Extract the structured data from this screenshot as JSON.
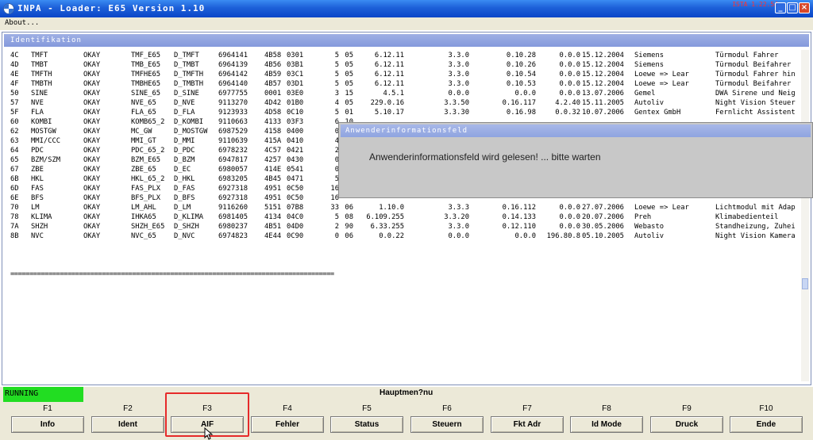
{
  "window": {
    "title": "INPA - Loader:  E65 Version 1.10",
    "watermark": "ISTA 1.22.54",
    "icons": {
      "minimize": "minimize-icon",
      "maximize": "maximize-icon",
      "close": "close-icon"
    }
  },
  "menu": {
    "about": "About..."
  },
  "panel": {
    "title": "Identifikation"
  },
  "table": {
    "rows": [
      [
        "4C",
        "TMFT",
        "OKAY",
        "TMF_E65",
        "D_TMFT",
        "6964141",
        "4B58",
        "0301",
        "5",
        "05",
        "6.12.11",
        "3.3.0",
        "0.10.28",
        "0.0.0",
        "15.12.2004",
        "Siemens",
        "Türmodul Fahrer"
      ],
      [
        "4D",
        "TMBT",
        "OKAY",
        "TMB_E65",
        "D_TMBT",
        "6964139",
        "4B56",
        "03B1",
        "5",
        "05",
        "6.12.11",
        "3.3.0",
        "0.10.26",
        "0.0.0",
        "15.12.2004",
        "Siemens",
        "Türmodul Beifahrer"
      ],
      [
        "4E",
        "TMFTH",
        "OKAY",
        "TMFHE65",
        "D_TMFTH",
        "6964142",
        "4B59",
        "03C1",
        "5",
        "05",
        "6.12.11",
        "3.3.0",
        "0.10.54",
        "0.0.0",
        "15.12.2004",
        "Loewe => Lear",
        "Türmodul Fahrer hin"
      ],
      [
        "4F",
        "TMBTH",
        "OKAY",
        "TMBHE65",
        "D_TMBTH",
        "6964140",
        "4B57",
        "03D1",
        "5",
        "05",
        "6.12.11",
        "3.3.0",
        "0.10.53",
        "0.0.0",
        "15.12.2004",
        "Loewe => Lear",
        "Türmodul Beifahrer"
      ],
      [
        "50",
        "SINE",
        "OKAY",
        "SINE_65",
        "D_SINE",
        "6977755",
        "0001",
        "03E0",
        "3",
        "15",
        "4.5.1",
        "0.0.0",
        "0.0.0",
        "0.0.0",
        "13.07.2006",
        "Gemel",
        "DWA Sirene und Neig"
      ],
      [
        "57",
        "NVE",
        "OKAY",
        "NVE_65",
        "D_NVE",
        "9113270",
        "4D42",
        "01B0",
        "4",
        "05",
        "229.0.16",
        "3.3.50",
        "0.16.117",
        "4.2.40",
        "15.11.2005",
        "Autoliv",
        "Night Vision Steuer"
      ],
      [
        "5F",
        "FLA",
        "OKAY",
        "FLA_65",
        "D_FLA",
        "9123933",
        "4D58",
        "0C10",
        "5",
        "01",
        "5.10.17",
        "3.3.30",
        "0.16.98",
        "0.0.32",
        "10.07.2006",
        "Gentex GmbH",
        "Fernlicht Assistent"
      ],
      [
        "60",
        "KOMBI",
        "OKAY",
        "KOMB65_2",
        "D_KOMBI",
        "9110663",
        "4133",
        "03F3",
        "6",
        "10",
        "",
        "",
        "",
        "",
        "",
        "",
        ""
      ],
      [
        "62",
        "MOSTGW",
        "OKAY",
        "MC_GW",
        "D_MOSTGW",
        "6987529",
        "4158",
        "0400",
        "0",
        "",
        "",
        "",
        "",
        "",
        "",
        "",
        ""
      ],
      [
        "63",
        "MMI/CCC",
        "OKAY",
        "MMI_GT",
        "D_MMI",
        "9110639",
        "415A",
        "0410",
        "4",
        "",
        "",
        "",
        "",
        "",
        "",
        "",
        ""
      ],
      [
        "64",
        "PDC",
        "OKAY",
        "PDC_65_2",
        "D_PDC",
        "6978232",
        "4C57",
        "0421",
        "2",
        "",
        "",
        "",
        "",
        "",
        "",
        "",
        ""
      ],
      [
        "65",
        "BZM/SZM",
        "OKAY",
        "BZM_E65",
        "D_BZM",
        "6947817",
        "4257",
        "0430",
        "0",
        "",
        "",
        "",
        "",
        "",
        "",
        "",
        ""
      ],
      [
        "67",
        "ZBE",
        "OKAY",
        "ZBE_65",
        "D_EC",
        "6980057",
        "414E",
        "0541",
        "0",
        "",
        "",
        "",
        "",
        "",
        "",
        "",
        ""
      ],
      [
        "6B",
        "HKL",
        "OKAY",
        "HKL_65_2",
        "D_HKL",
        "6983205",
        "4B45",
        "0471",
        "5",
        "",
        "",
        "",
        "",
        "",
        "",
        "",
        ""
      ],
      [
        "6D",
        "FAS",
        "OKAY",
        "FAS_PLX",
        "D_FAS",
        "6927318",
        "4951",
        "0C50",
        "16",
        "",
        "",
        "",
        "",
        "",
        "",
        "",
        ""
      ],
      [
        "6E",
        "BFS",
        "OKAY",
        "BFS_PLX",
        "D_BFS",
        "6927318",
        "4951",
        "0C50",
        "16",
        "",
        "",
        "",
        "",
        "",
        "",
        "",
        ""
      ],
      [
        "70",
        "LM",
        "OKAY",
        "LM_AHL",
        "D_LM",
        "9116260",
        "5151",
        "07B8",
        "33",
        "06",
        "1.10.0",
        "3.3.3",
        "0.16.112",
        "0.0.0",
        "27.07.2006",
        "Loewe => Lear",
        "Lichtmodul mit Adap"
      ],
      [
        "78",
        "KLIMA",
        "OKAY",
        "IHKA65",
        "D_KLIMA",
        "6981405",
        "4134",
        "04C0",
        "5",
        "08",
        "6.109.255",
        "3.3.20",
        "0.14.133",
        "0.0.0",
        "20.07.2006",
        "Preh",
        "Klimabedienteil"
      ],
      [
        "7A",
        "SHZH",
        "OKAY",
        "SHZH_E65",
        "D_SHZH",
        "6980237",
        "4B51",
        "04D0",
        "2",
        "90",
        "6.33.255",
        "3.3.0",
        "0.12.110",
        "0.0.0",
        "30.05.2006",
        "Webasto",
        "Standheizung, Zuhei"
      ],
      [
        "8B",
        "NVC",
        "OKAY",
        "NVC_65",
        "D_NVC",
        "6974823",
        "4E44",
        "0C90",
        "0",
        "06",
        "0.0.22",
        "0.0.0",
        "0.0.0",
        "196.80.8",
        "05.10.2005",
        "Autoliv",
        "Night Vision Kamera"
      ]
    ],
    "separator": "====================================================================================="
  },
  "dialog": {
    "title": "Anwenderinformationsfeld",
    "message": "Anwenderinformationsfeld wird gelesen! ... bitte warten"
  },
  "status": {
    "running": "RUNNING",
    "menu_title": "Hauptmen?nu",
    "running_color": "#22dd22"
  },
  "function_keys": [
    {
      "key": "F1",
      "label": "Info"
    },
    {
      "key": "F2",
      "label": "Ident"
    },
    {
      "key": "F3",
      "label": "AIF"
    },
    {
      "key": "F4",
      "label": "Fehler"
    },
    {
      "key": "F5",
      "label": "Status"
    },
    {
      "key": "F6",
      "label": "Steuern"
    },
    {
      "key": "F7",
      "label": "Fkt Adr"
    },
    {
      "key": "F8",
      "label": "Id Mode"
    },
    {
      "key": "F9",
      "label": "Druck"
    },
    {
      "key": "F10",
      "label": "Ende"
    }
  ],
  "highlight": {
    "color": "#e62a2a",
    "target": "F3"
  },
  "cursor": {
    "icon": "mouse-pointer-icon"
  }
}
